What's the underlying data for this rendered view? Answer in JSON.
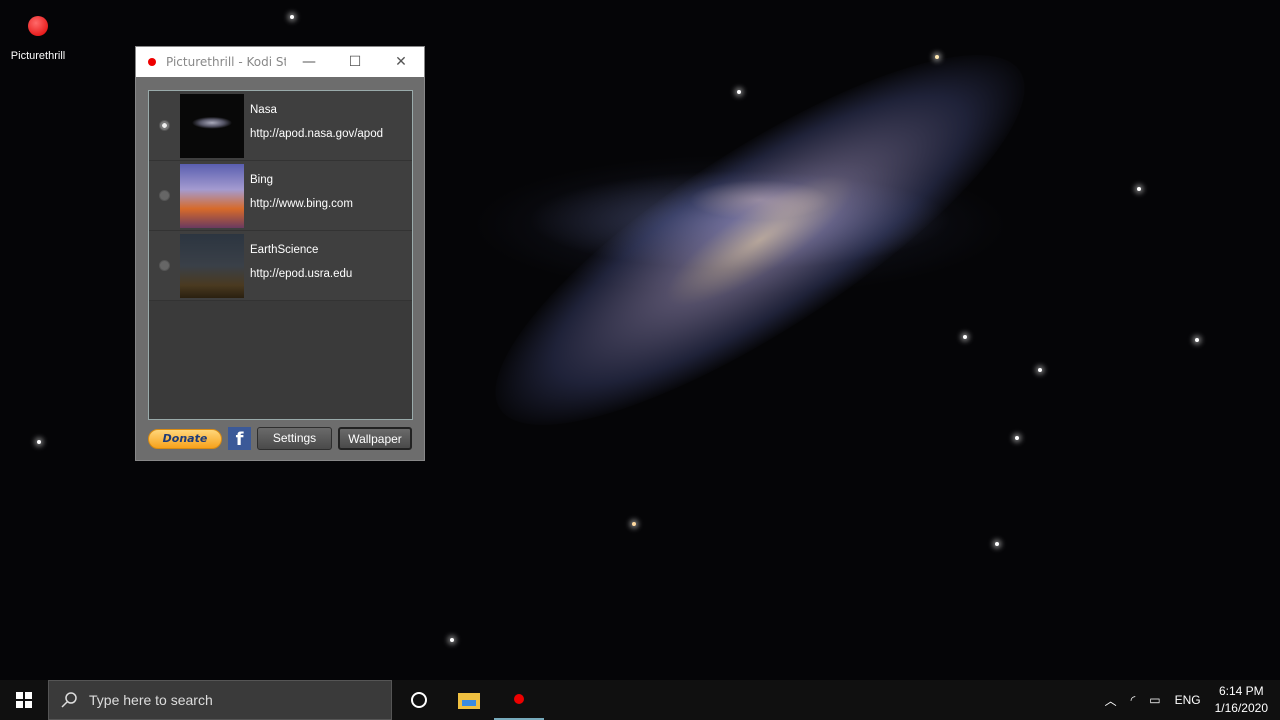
{
  "desktop": {
    "icon_label": "Picturethrill"
  },
  "window": {
    "title": "Picturethrill - Kodi St...",
    "minimize": "—",
    "maximize": "☐",
    "close": "✕",
    "sources": [
      {
        "name": "Nasa",
        "url": "http://apod.nasa.gov/apod",
        "selected": true
      },
      {
        "name": "Bing",
        "url": "http://www.bing.com",
        "selected": false
      },
      {
        "name": "EarthScience",
        "url": "http://epod.usra.edu",
        "selected": false
      }
    ],
    "donate_label": "Donate",
    "facebook_label": "f",
    "settings_label": "Settings",
    "wallpaper_label": "Wallpaper"
  },
  "taskbar": {
    "search_placeholder": "Type here to search",
    "language": "ENG",
    "time": "6:14 PM",
    "date": "1/16/2020"
  }
}
